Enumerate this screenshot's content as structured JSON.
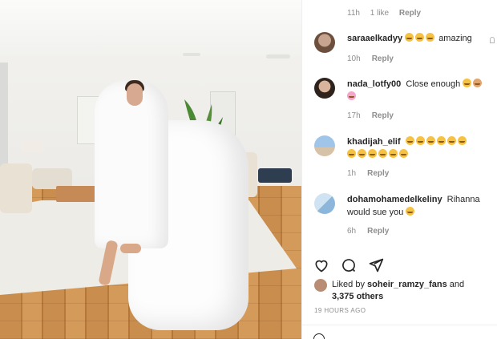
{
  "colors": {
    "text": "#262626",
    "muted": "#8e8e8e",
    "emoji": "#f6c244"
  },
  "top_cut": {
    "time": "11h",
    "like": "1 like",
    "reply": "Reply"
  },
  "comments": [
    {
      "username": "saraaelkadyy",
      "text": "amazing",
      "emoji_before": 3,
      "emoji_after": 0,
      "time": "10h",
      "reply": "Reply"
    },
    {
      "username": "nada_lotfy00",
      "text": "Close enough",
      "emoji_before": 0,
      "emoji_after": 2,
      "time": "17h",
      "reply": "Reply"
    },
    {
      "username": "khadijah_elif",
      "text": "",
      "emoji_before": 0,
      "emoji_after": 12,
      "time": "1h",
      "reply": "Reply"
    },
    {
      "username": "dohamohamedelkeliny",
      "text": "Rihanna would sue you",
      "emoji_before": 0,
      "emoji_after": 1,
      "time": "6h",
      "reply": "Reply"
    }
  ],
  "actions": {
    "icons": [
      "heart-icon",
      "comment-icon",
      "share-icon"
    ]
  },
  "likes": {
    "prefix": "Liked by",
    "user": "soheir_ramzy_fans",
    "and": "and",
    "others": "3,375 others"
  },
  "timestamp": "19 HOURS AGO"
}
